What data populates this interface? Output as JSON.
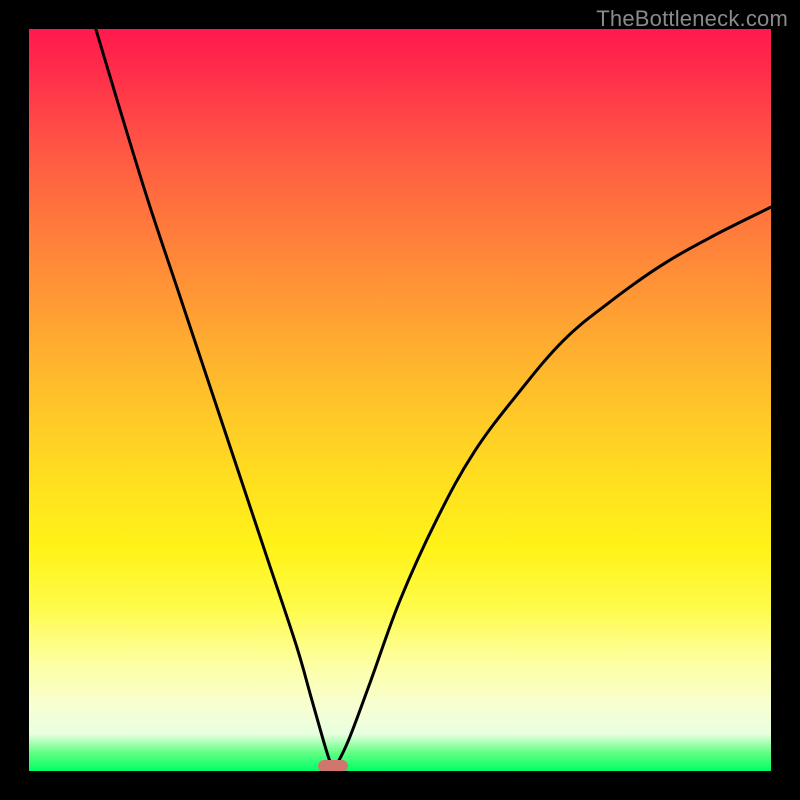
{
  "watermark": "TheBottleneck.com",
  "colors": {
    "frame": "#000000",
    "curve": "#000000",
    "bump": "#d1766f",
    "gradient_top": "#ff1a4d",
    "gradient_bottom": "#00ff66"
  },
  "chart_data": {
    "type": "line",
    "title": "",
    "xlabel": "",
    "ylabel": "",
    "xlim": [
      0,
      100
    ],
    "ylim": [
      0,
      100
    ],
    "grid": false,
    "legend": false,
    "annotations": [
      {
        "name": "minimum-marker",
        "x": 41,
        "y": 0,
        "shape": "pill",
        "color": "#d1766f"
      }
    ],
    "series": [
      {
        "name": "left-branch",
        "x": [
          9,
          12,
          16,
          20,
          24,
          28,
          32,
          36,
          38,
          40,
          41
        ],
        "y": [
          100,
          90,
          77,
          65,
          53,
          41,
          29,
          17,
          10,
          3,
          0
        ]
      },
      {
        "name": "right-branch",
        "x": [
          41,
          43,
          46,
          50,
          55,
          60,
          66,
          72,
          78,
          85,
          92,
          100
        ],
        "y": [
          0,
          4,
          12,
          23,
          34,
          43,
          51,
          58,
          63,
          68,
          72,
          76
        ]
      }
    ],
    "background_gradient": {
      "type": "vertical",
      "stops": [
        {
          "pos": 0,
          "color": "#ff1a4d"
        },
        {
          "pos": 50,
          "color": "#ffc828"
        },
        {
          "pos": 70,
          "color": "#fff318"
        },
        {
          "pos": 97,
          "color": "#63ff84"
        },
        {
          "pos": 100,
          "color": "#00ff66"
        }
      ]
    }
  }
}
